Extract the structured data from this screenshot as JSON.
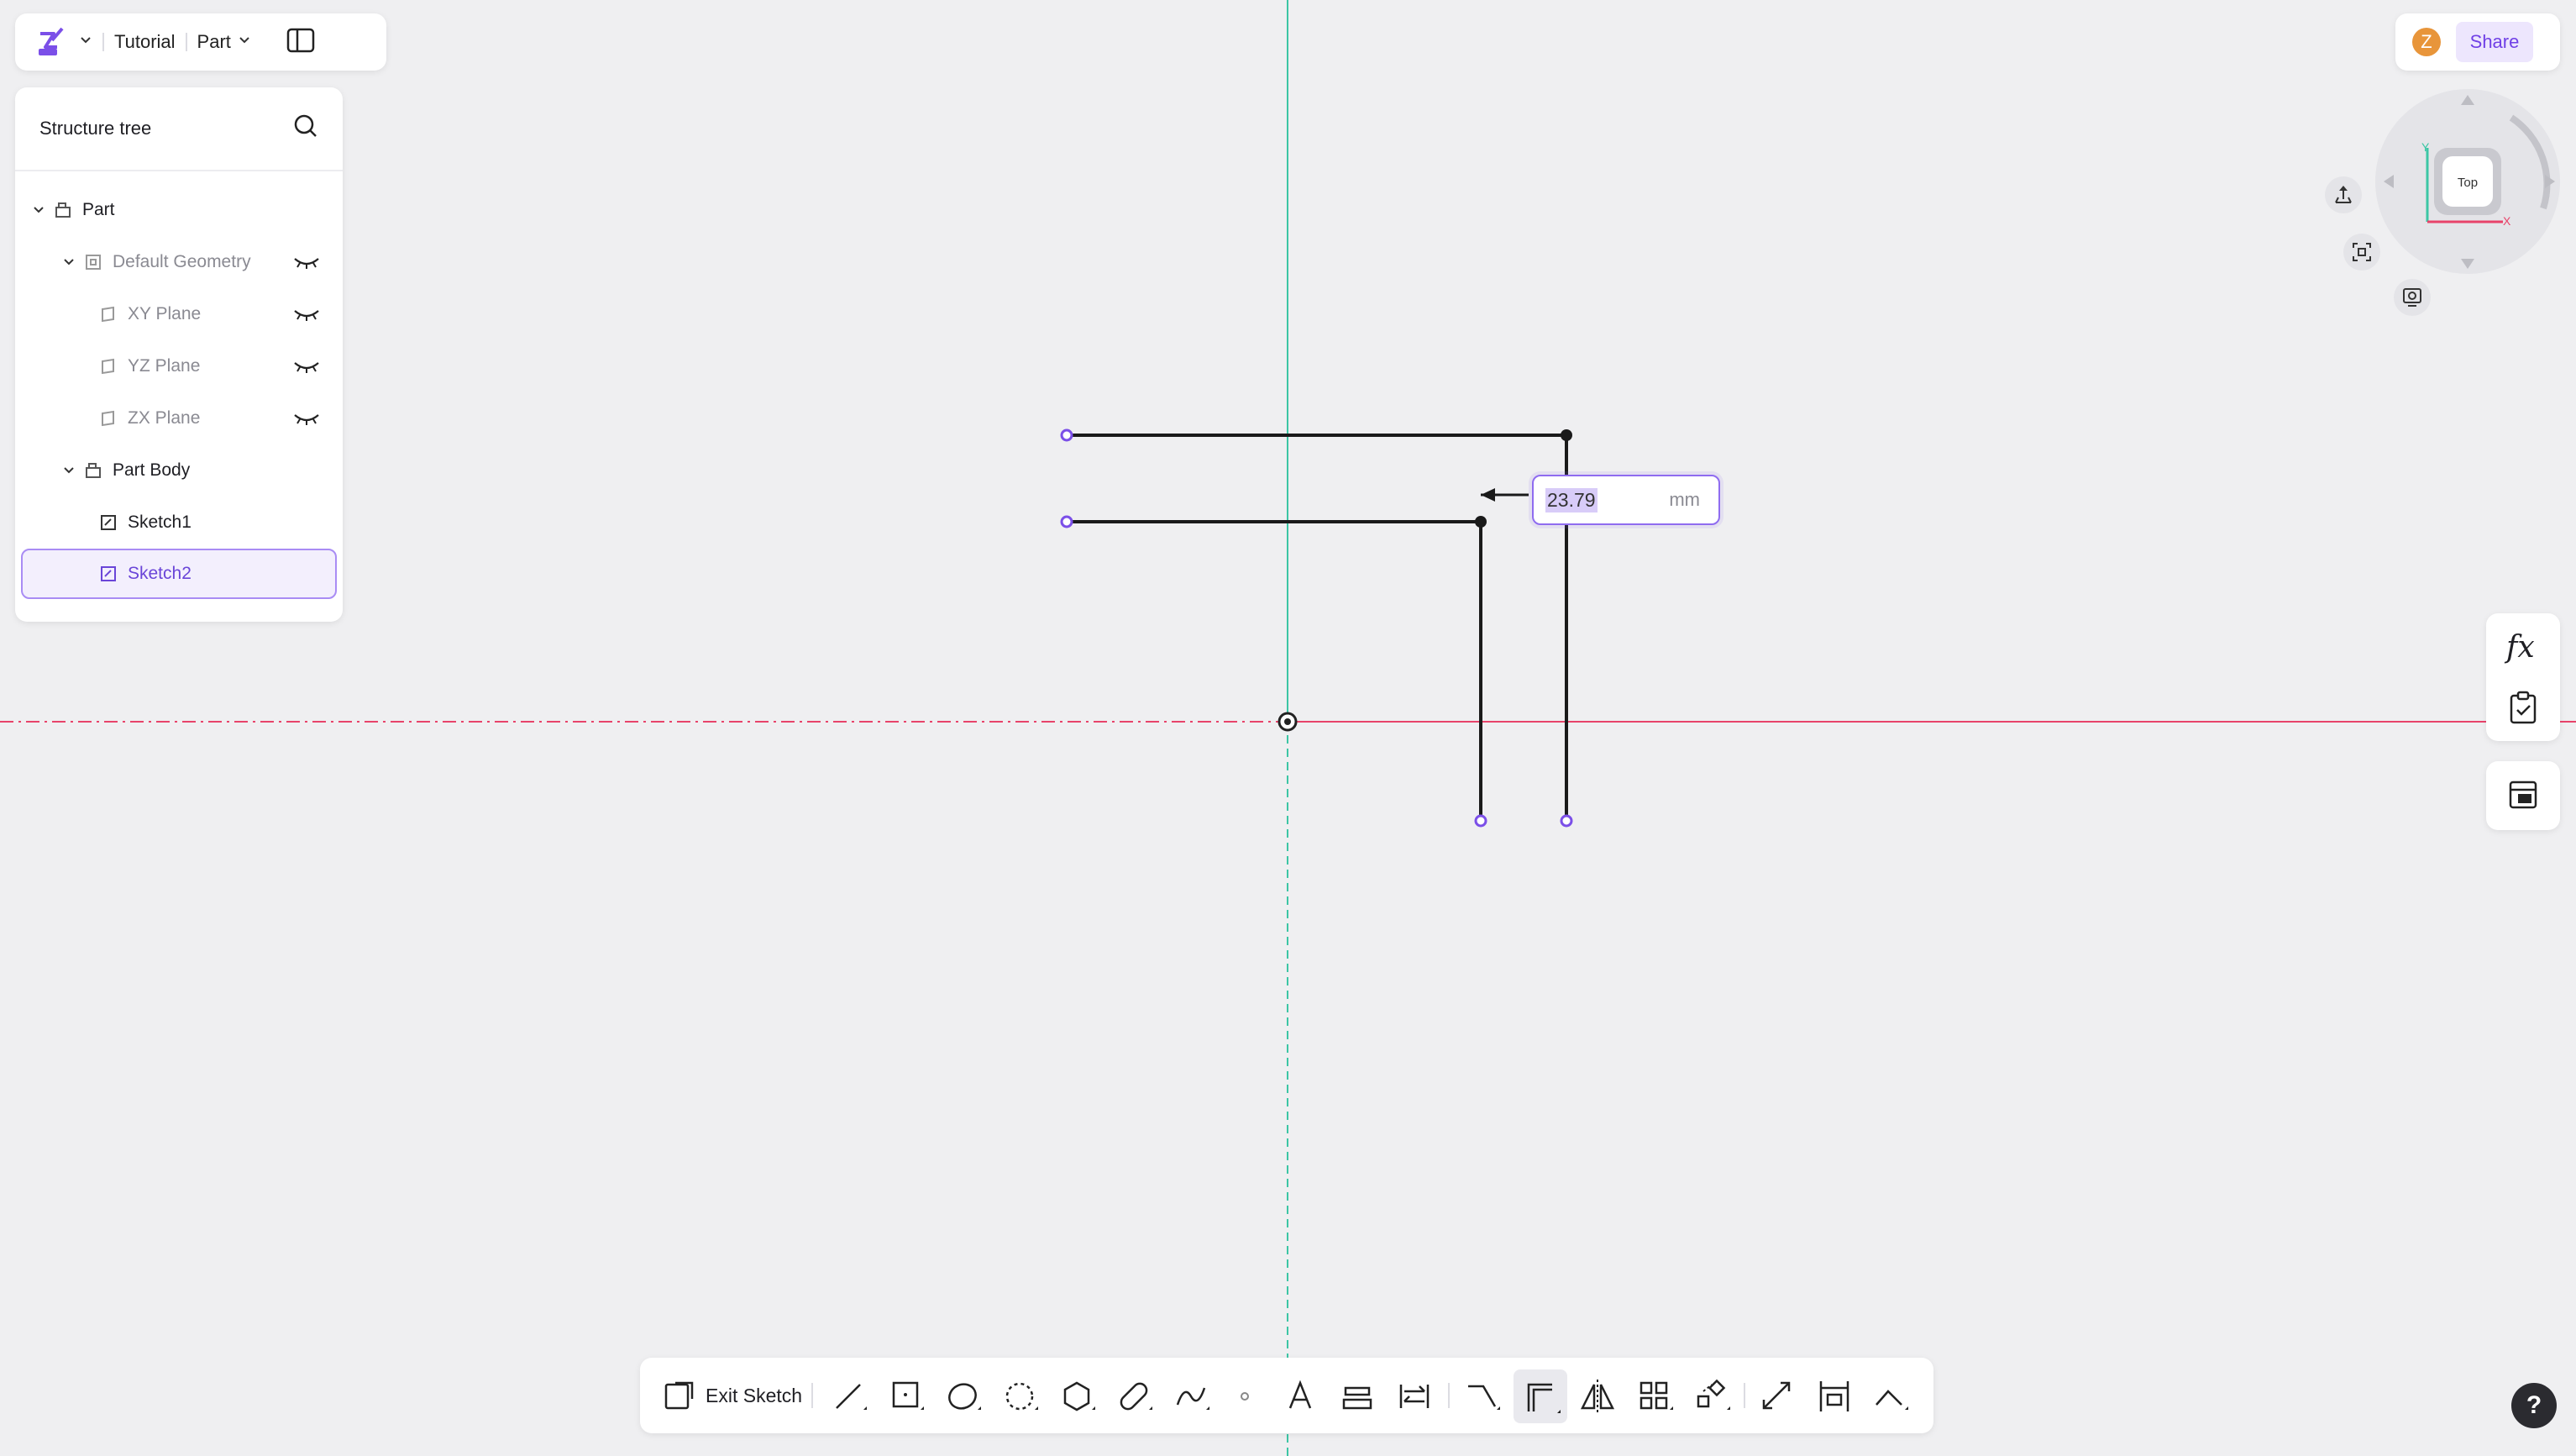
{
  "topbar": {
    "project": "Tutorial",
    "mode": "Part"
  },
  "tree": {
    "title": "Structure tree",
    "items": [
      {
        "label": "Part"
      },
      {
        "label": "Default Geometry"
      },
      {
        "label": "XY Plane"
      },
      {
        "label": "YZ Plane"
      },
      {
        "label": "ZX Plane"
      },
      {
        "label": "Part Body"
      },
      {
        "label": "Sketch1"
      },
      {
        "label": "Sketch2"
      }
    ]
  },
  "user": {
    "avatar_letter": "Z",
    "share_label": "Share"
  },
  "viewcube": {
    "face": "Top",
    "axis_x": "X",
    "axis_y": "Y"
  },
  "dimension": {
    "value": "23.79",
    "unit": "mm"
  },
  "toolbar": {
    "exit_label": "Exit Sketch"
  },
  "help": {
    "label": "?"
  },
  "colors": {
    "accent": "#7b4fe8",
    "x_axis": "#e8436a",
    "y_axis": "#3cc6a5"
  }
}
